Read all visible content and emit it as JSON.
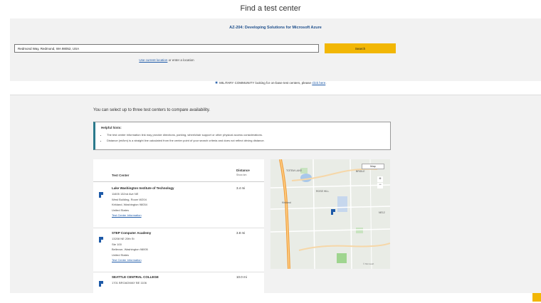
{
  "page": {
    "title": "Find a test center",
    "exam_title": "AZ-204: Developing Solutions for Microsoft Azure"
  },
  "search": {
    "value": "Redmond Way, Redmond, WA 98052, USA",
    "button_label": "Search",
    "use_location_link": "Use current location",
    "use_location_suffix": " or enter a location"
  },
  "military": {
    "text": "MILITARY COMMUNITY looking for on-base test centers, please ",
    "link": "click here",
    "period": "."
  },
  "compare_text": "You can select up to three test centers to compare availability.",
  "helpful_hints": {
    "title": "Helpful hints:",
    "items": [
      "The test center information link may provide directions, parking, wheelchair support or other physical access considerations.",
      "Distance (mi/km) is a straight line calculated from the center point of your search criteria and does not reflect driving distance."
    ]
  },
  "results": {
    "col_name": "Test Center",
    "col_distance": "Distance",
    "col_distance_sub": "Show km",
    "centers": [
      {
        "name": "Lake Washington Institute of Technology",
        "lines": [
          "11605 132nd Ave NE",
          "West Building, Room W204",
          "Kirkland, Washington 98034",
          "United States"
        ],
        "info_link": "Test Center Information",
        "distance": "3.4 mi"
      },
      {
        "name": "STEP Computer Academy",
        "lines": [
          "13208 NE 20th St",
          "Ste 100",
          "Bellevue, Washington 98005",
          "United States"
        ],
        "info_link": "Test Center Information",
        "distance": "3.8 mi"
      },
      {
        "name": "SEATTLE CENTRAL COLLEGE",
        "lines": [
          "1701 BROADWAY BE 1106"
        ],
        "info_link": "",
        "distance": "10.0 mi"
      }
    ]
  },
  "map": {
    "view_label": "Map",
    "zoom_in": "+",
    "zoom_out": "−",
    "labels": {
      "totem_lake": "TOTEM LAKE",
      "bridle": "BRIDLE",
      "rose_hill": "ROSE HILL",
      "city": "Kirkland",
      "right": "NE12",
      "attribution": "© Microsoft"
    }
  },
  "colors": {
    "accent_yellow": "#f2b705",
    "link_blue": "#1e5aa8",
    "exam_blue": "#1e4f8c",
    "hint_border": "#2a7a8c",
    "band_gray": "#f2f2f2"
  }
}
